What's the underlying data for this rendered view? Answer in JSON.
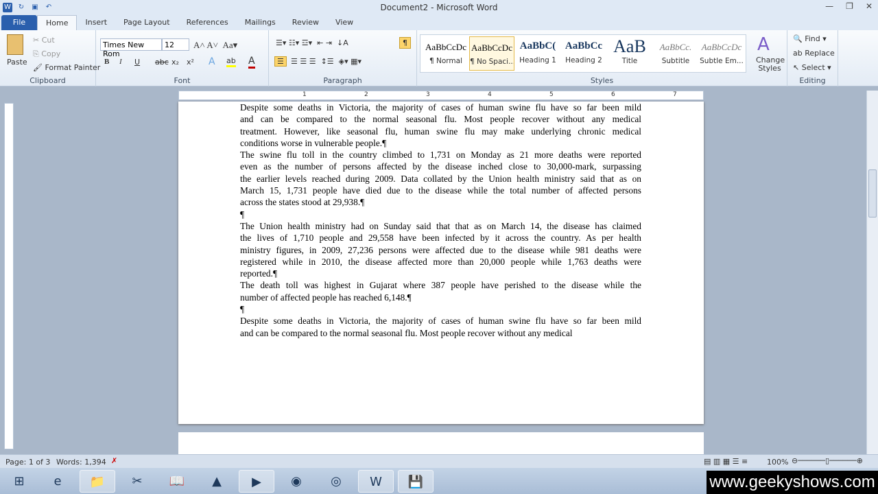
{
  "window": {
    "title": "Document2 - Microsoft Word",
    "minimize": "—",
    "restore": "❐",
    "close": "✕"
  },
  "tabs": [
    "File",
    "Home",
    "Insert",
    "Page Layout",
    "References",
    "Mailings",
    "Review",
    "View"
  ],
  "clipboard": {
    "paste": "Paste",
    "cut": "Cut",
    "copy": "Copy",
    "format_painter": "Format Painter",
    "label": "Clipboard"
  },
  "font": {
    "name": "Times New Rom",
    "size": "12",
    "label": "Font",
    "bold": "B",
    "italic": "I",
    "underline": "U",
    "strike": "abc",
    "sub": "x₂",
    "sup": "x²",
    "color_accent": "#c00000"
  },
  "paragraph": {
    "label": "Paragraph",
    "pilcrow": "¶"
  },
  "styles": {
    "label": "Styles",
    "items": [
      {
        "preview": "AaBbCcDc",
        "name": "¶ Normal"
      },
      {
        "preview": "AaBbCcDc",
        "name": "¶ No Spaci...",
        "selected": true
      },
      {
        "preview": "AaBbC(",
        "name": "Heading 1"
      },
      {
        "preview": "AaBbCc",
        "name": "Heading 2"
      },
      {
        "preview": "AaB",
        "name": "Title"
      },
      {
        "preview": "AaBbCc.",
        "name": "Subtitle"
      },
      {
        "preview": "AaBbCcDc",
        "name": "Subtle Em..."
      }
    ],
    "change_styles": "Change Styles"
  },
  "editing": {
    "label": "Editing",
    "find": "Find",
    "replace": "Replace",
    "select": "Select"
  },
  "document": {
    "lines": [
      [
        "Despite some deaths in Victoria, the majority of cases of human swine flu have so far been mild",
        0
      ],
      [
        "and can be compared to the normal seasonal flu. Most people recover without any medical",
        0
      ],
      [
        "treatment. However, like seasonal flu, human swine flu may make underlying chronic medical",
        0
      ],
      [
        "conditions worse in vulnerable people.¶",
        1
      ],
      [
        "The swine flu toll in the country climbed to 1,731 on Monday as 21 more deaths were reported",
        0
      ],
      [
        "even as the number of persons affected by the disease inched close to 30,000-mark, surpassing",
        0
      ],
      [
        "the earlier levels reached during 2009. Data collated by the Union health ministry said that as on",
        0
      ],
      [
        "March 15, 1,731 people have died due to the disease while the total number of affected persons",
        0
      ],
      [
        "across the states stood at 29,938.¶",
        1
      ],
      [
        "¶",
        1
      ],
      [
        "The Union health ministry had on Sunday said that that as on March 14, the disease has claimed",
        0
      ],
      [
        "the lives of 1,710 people and 29,558 have been infected by it across the country. As per health",
        0
      ],
      [
        "ministry figures, in 2009, 27,236 persons were affected due to the disease while 981 deaths were",
        0
      ],
      [
        "registered while in 2010, the disease affected more than 20,000 people while 1,763 deaths were",
        0
      ],
      [
        "reported.¶",
        1
      ],
      [
        "The death toll was highest in Gujarat where 387 people have perished to the disease while the",
        0
      ],
      [
        "number of affected people has reached 6,148.¶",
        1
      ],
      [
        "¶",
        1
      ],
      [
        "Despite some deaths in Victoria, the majority of cases of human swine flu have so far been mild",
        0
      ],
      [
        "and can be compared to the normal seasonal flu. Most people recover without any medical",
        1
      ]
    ]
  },
  "ruler": [
    "1",
    "2",
    "3",
    "4",
    "5",
    "6",
    "7"
  ],
  "status": {
    "page": "Page: 1 of 3",
    "words": "Words: 1,394",
    "zoom": "100%"
  },
  "taskbar": [
    "⊞",
    "e",
    "📁",
    "✂",
    "📖",
    "▲",
    "▶",
    "◉",
    "◎",
    "W",
    "💾"
  ],
  "watermark": "www.geekyshows.com"
}
